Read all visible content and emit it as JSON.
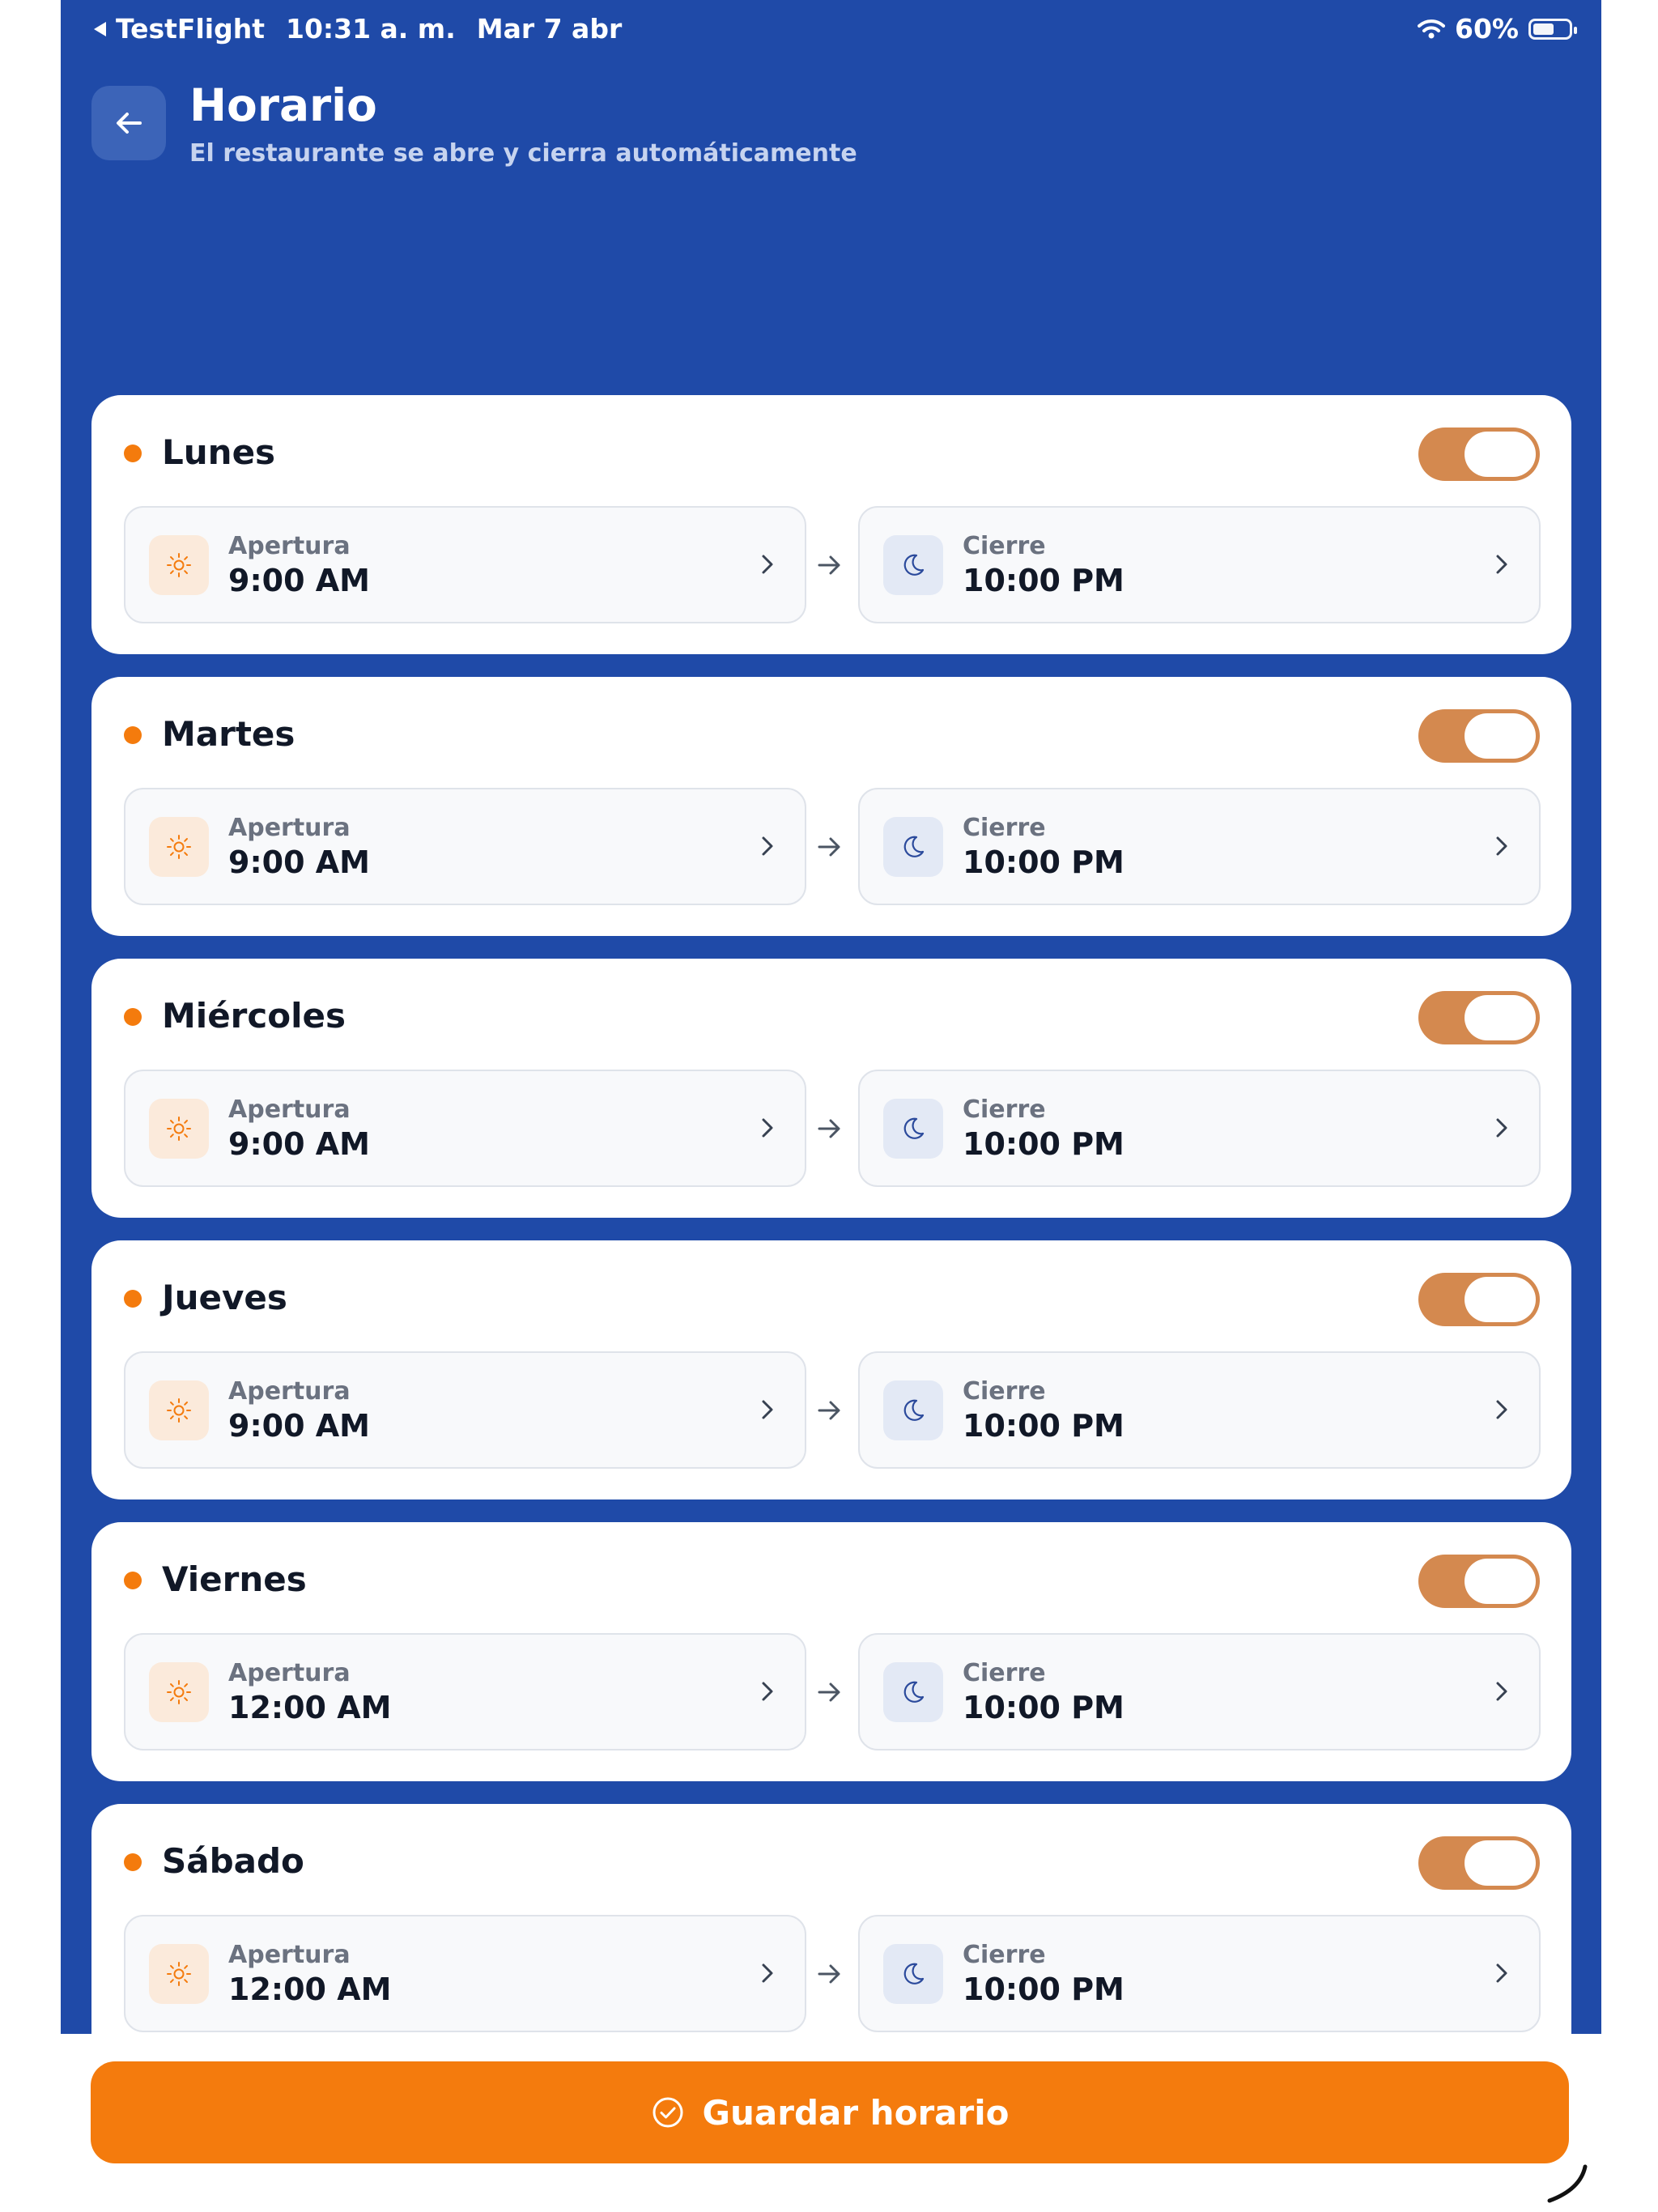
{
  "status_bar": {
    "back_app": "TestFlight",
    "time": "10:31 a. m.",
    "date": "Mar 7 abr",
    "battery_percent": "60%",
    "battery_level": 0.6
  },
  "header": {
    "title": "Horario",
    "subtitle": "El restaurante se abre y cierra automáticamente"
  },
  "colors": {
    "header_bg": "#1f4aa8",
    "accent": "#f47b0d",
    "toggle_on": "#d4894f"
  },
  "icons": {
    "open": "sun-icon",
    "close": "moon-icon",
    "chevron": "chevron-right-icon",
    "arrow": "arrow-right-icon",
    "back": "arrow-left-icon",
    "save": "check-circle-icon"
  },
  "days": [
    {
      "name": "Lunes",
      "enabled": true,
      "open_label": "Apertura",
      "open_time": "9:00 AM",
      "close_label": "Cierre",
      "close_time": "10:00 PM"
    },
    {
      "name": "Martes",
      "enabled": true,
      "open_label": "Apertura",
      "open_time": "9:00 AM",
      "close_label": "Cierre",
      "close_time": "10:00 PM"
    },
    {
      "name": "Miércoles",
      "enabled": true,
      "open_label": "Apertura",
      "open_time": "9:00 AM",
      "close_label": "Cierre",
      "close_time": "10:00 PM"
    },
    {
      "name": "Jueves",
      "enabled": true,
      "open_label": "Apertura",
      "open_time": "9:00 AM",
      "close_label": "Cierre",
      "close_time": "10:00 PM"
    },
    {
      "name": "Viernes",
      "enabled": true,
      "open_label": "Apertura",
      "open_time": "12:00 AM",
      "close_label": "Cierre",
      "close_time": "10:00 PM"
    },
    {
      "name": "Sábado",
      "enabled": true,
      "open_label": "Apertura",
      "open_time": "12:00 AM",
      "close_label": "Cierre",
      "close_time": "10:00 PM"
    }
  ],
  "footer": {
    "save_label": "Guardar horario"
  }
}
